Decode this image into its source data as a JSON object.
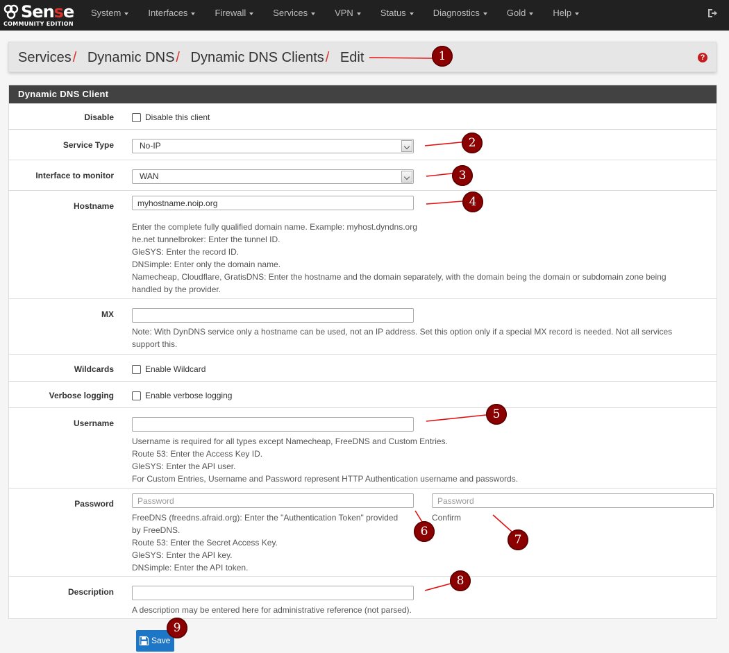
{
  "app": {
    "logo_text_main": "Sen",
    "logo_text_accent": "s",
    "logo_text_end": "e",
    "logo_subtitle": "COMMUNITY EDITION"
  },
  "nav": {
    "items": [
      {
        "label": "System"
      },
      {
        "label": "Interfaces"
      },
      {
        "label": "Firewall"
      },
      {
        "label": "Services"
      },
      {
        "label": "VPN"
      },
      {
        "label": "Status"
      },
      {
        "label": "Diagnostics"
      },
      {
        "label": "Gold"
      },
      {
        "label": "Help"
      }
    ]
  },
  "breadcrumb": {
    "items": [
      "Services",
      "Dynamic DNS",
      "Dynamic DNS Clients",
      "Edit"
    ],
    "separator": "/",
    "help_glyph": "?"
  },
  "panel": {
    "title": "Dynamic DNS Client"
  },
  "form": {
    "disable": {
      "label": "Disable",
      "checkbox_text": "Disable this client"
    },
    "service_type": {
      "label": "Service Type",
      "value": "No-IP"
    },
    "interface": {
      "label": "Interface to monitor",
      "value": "WAN"
    },
    "hostname": {
      "label": "Hostname",
      "value": "myhostname.noip.org",
      "help": [
        "Enter the complete fully qualified domain name. Example: myhost.dyndns.org",
        "he.net tunnelbroker: Enter the tunnel ID.",
        "GleSYS: Enter the record ID.",
        "DNSimple: Enter only the domain name.",
        "Namecheap, Cloudflare, GratisDNS: Enter the hostname and the domain separately, with the domain being the domain or subdomain zone being",
        "handled by the provider."
      ]
    },
    "mx": {
      "label": "MX",
      "value": "",
      "help": [
        "Note: With DynDNS service only a hostname can be used, not an IP address. Set this option only if a special MX record is needed. Not all services",
        "support this."
      ]
    },
    "wildcards": {
      "label": "Wildcards",
      "checkbox_text": "Enable Wildcard"
    },
    "verbose": {
      "label": "Verbose logging",
      "checkbox_text": "Enable verbose logging"
    },
    "username": {
      "label": "Username",
      "value": "",
      "help": [
        "Username is required for all types except Namecheap, FreeDNS and Custom Entries.",
        "Route 53: Enter the Access Key ID.",
        "GleSYS: Enter the API user.",
        "For Custom Entries, Username and Password represent HTTP Authentication username and passwords."
      ]
    },
    "password": {
      "label": "Password",
      "placeholder": "Password",
      "confirm_placeholder": "Password",
      "confirm_label": "Confirm",
      "help": [
        "FreeDNS (freedns.afraid.org): Enter the \"Authentication Token\" provided",
        "by FreeDNS.",
        "Route 53: Enter the Secret Access Key.",
        "GleSYS: Enter the API key.",
        "DNSimple: Enter the API token."
      ]
    },
    "description": {
      "label": "Description",
      "value": "",
      "help": [
        "A description may be entered here for administrative reference (not parsed)."
      ]
    }
  },
  "save_button": {
    "label": "Save"
  },
  "annotations": [
    "1",
    "2",
    "3",
    "4",
    "5",
    "6",
    "7",
    "8",
    "9"
  ],
  "colors": {
    "navbar_bg": "#212121",
    "accent_red": "#d9322c",
    "panel_heading_bg": "#424242",
    "save_button_bg": "#1e76c7",
    "marker_bg": "#8b0000"
  }
}
